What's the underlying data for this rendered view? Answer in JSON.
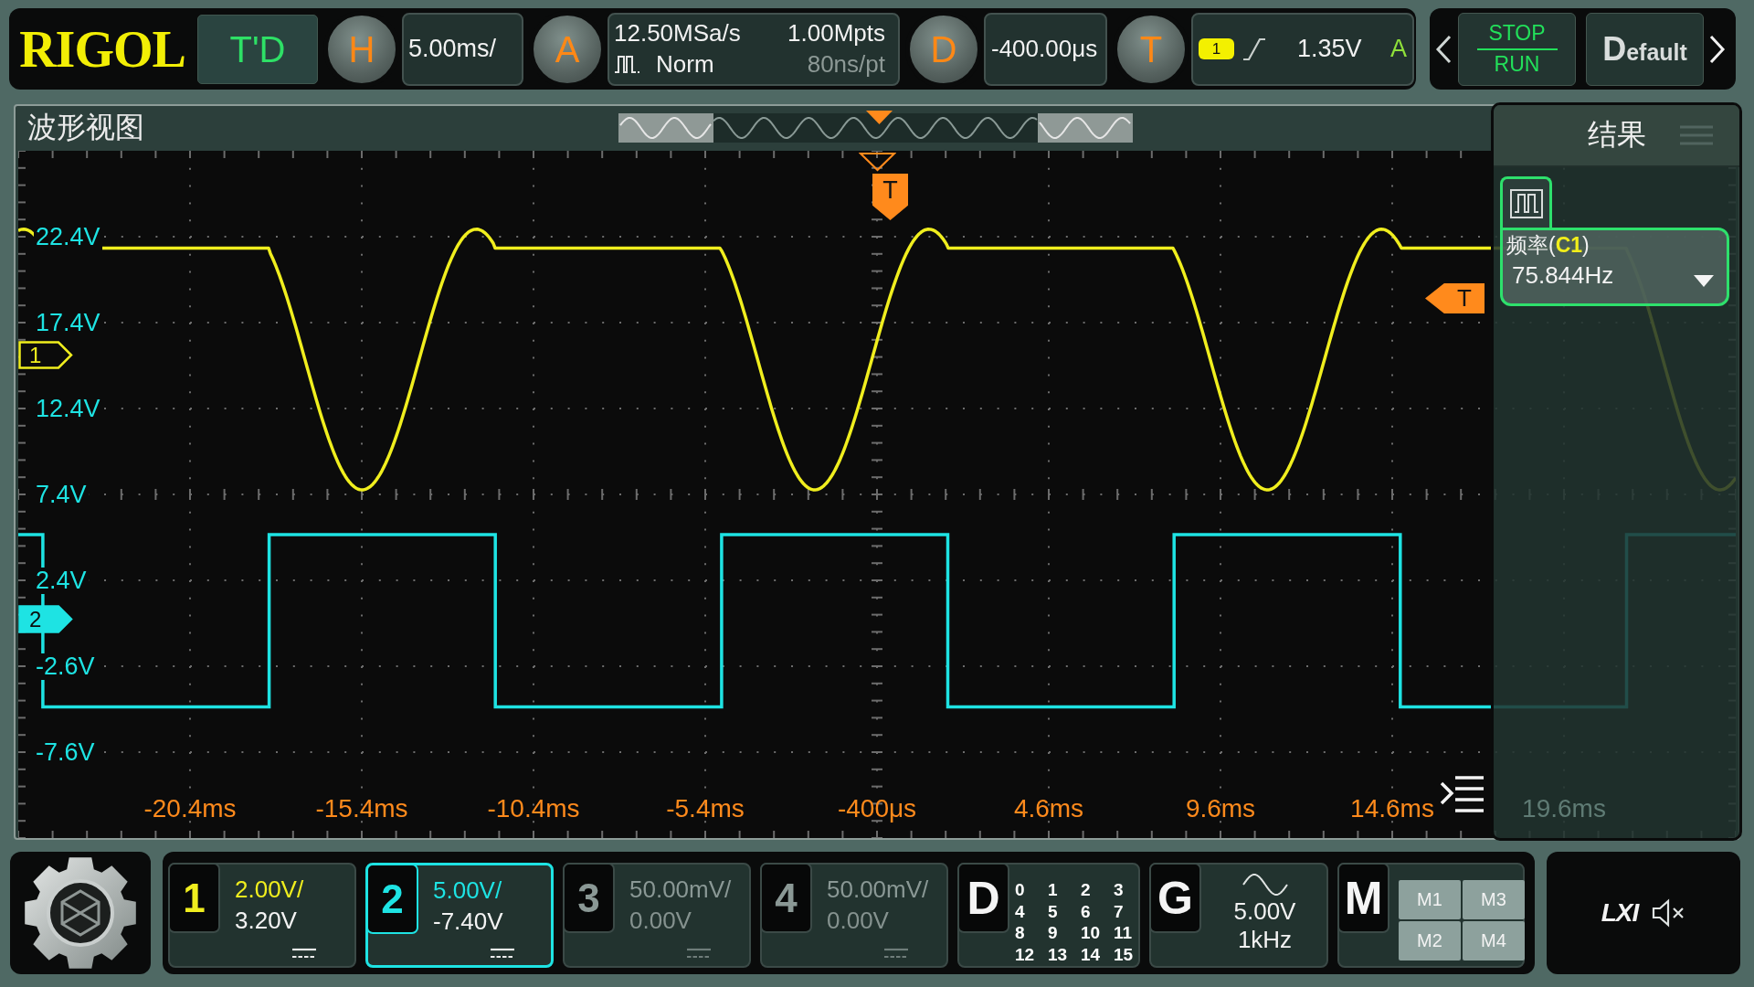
{
  "top_bar": {
    "logo": "RIGOL",
    "mode_button": "T'D",
    "horizontal": {
      "key": "H",
      "scale": "5.00ms/"
    },
    "acquisition": {
      "key": "A",
      "sample_rate": "12.50MSa/s",
      "mode": "Norm",
      "memory_depth": "1.00Mpts",
      "sample_interval": "80ns/pt"
    },
    "delay": {
      "key": "D",
      "offset": "-400.00μs"
    },
    "trigger": {
      "key": "T",
      "source": "1",
      "rising": true,
      "level": "1.35V",
      "sweep": "A"
    }
  },
  "run_controls": {
    "run_stop": {
      "upper": "STOP",
      "lower": "RUN"
    },
    "default_button": "Default"
  },
  "waveform_view": {
    "title": "波形视图",
    "y_labels": [
      "22.4V",
      "17.4V",
      "12.4V",
      "7.4V",
      "2.4V",
      "-2.6V",
      "-7.6V"
    ],
    "x_labels": [
      "-20.4ms",
      "-15.4ms",
      "-10.4ms",
      "-5.4ms",
      "-400μs",
      "4.6ms",
      "9.6ms",
      "14.6ms",
      "19.6ms"
    ],
    "channel_markers": [
      {
        "label": "1",
        "color": "#f0ee1e",
        "selected": false
      },
      {
        "label": "2",
        "color": "#1ee3e3",
        "selected": true
      }
    ],
    "trigger_position_marker": "T",
    "trigger_level_marker": "T"
  },
  "results": {
    "title": "结果",
    "measurements": [
      {
        "label": "频率(**C1**)",
        "value": "75.844Hz"
      }
    ]
  },
  "bottom_bar": {
    "channels": [
      {
        "number": "1",
        "scale": "2.00V/",
        "offset": "3.20V",
        "color": "#f0ee1e",
        "enabled": true,
        "selected": false
      },
      {
        "number": "2",
        "scale": "5.00V/",
        "offset": "-7.40V",
        "color": "#1ee3e3",
        "enabled": true,
        "selected": true
      },
      {
        "number": "3",
        "scale": "50.00mV/",
        "offset": "0.00V",
        "color": "#8a9895",
        "enabled": false,
        "selected": false
      },
      {
        "number": "4",
        "scale": "50.00mV/",
        "offset": "0.00V",
        "color": "#8a9895",
        "enabled": false,
        "selected": false
      }
    ],
    "digital": {
      "key": "D",
      "channels": [
        "0",
        "1",
        "2",
        "3",
        "4",
        "5",
        "6",
        "7",
        "8",
        "9",
        "10",
        "11",
        "12",
        "13",
        "14",
        "15"
      ]
    },
    "generator": {
      "key": "G",
      "amplitude": "5.00V",
      "frequency": "1kHz"
    },
    "math": {
      "key": "M",
      "items": [
        "M1",
        "M3",
        "M2",
        "M4"
      ]
    },
    "status": {
      "lxi": "LXI",
      "muted": true
    }
  }
}
